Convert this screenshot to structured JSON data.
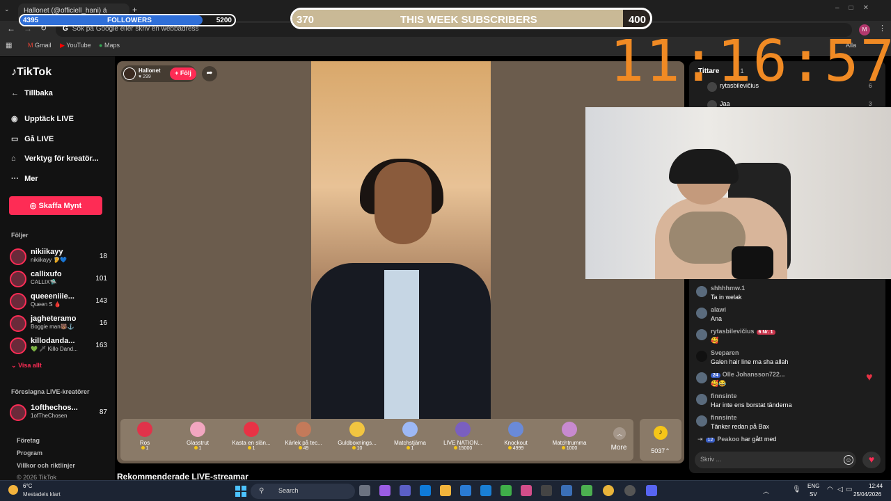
{
  "browser": {
    "tab_title": "Hallonet (@officiell_hani) ä",
    "omnibox_placeholder": "Sök på Google eller skriv en webbadress",
    "profile_initial": "M",
    "bookmarks": [
      "Gmail",
      "YouTube",
      "Maps"
    ],
    "all_bookmarks_label": "Alla"
  },
  "overlay": {
    "followers": {
      "label": "FOLLOWERS",
      "current": "4395",
      "goal": "5200",
      "progress": 0.85
    },
    "subscribers": {
      "label": "THIS WEEK SUBSCRIBERS",
      "current": "370",
      "goal": "400",
      "progress": 0.925
    },
    "clock": "11:16:57"
  },
  "sidebar": {
    "logo": "TikTok",
    "back_label": "Tillbaka",
    "nav": [
      {
        "label": "Upptäck LIVE",
        "icon": "live-avatar-icon"
      },
      {
        "label": "Gå LIVE",
        "icon": "video-camera-icon"
      },
      {
        "label": "Verktyg för kreatör...",
        "icon": "tools-icon"
      },
      {
        "label": "Mer",
        "icon": "more-dots-icon"
      }
    ],
    "coins_button": "Skaffa Mynt",
    "following_title": "Följer",
    "following": [
      {
        "name": "nikiikayy",
        "sub": "nikiikayy 🦻💙",
        "count": "18"
      },
      {
        "name": "callixufo",
        "sub": "CALLIX🛸",
        "count": "101"
      },
      {
        "name": "queeeniiie...",
        "sub": "Queen S 🩸",
        "count": "143"
      },
      {
        "name": "jagheteramo",
        "sub": "Boggie man🐻⚓",
        "count": "16"
      },
      {
        "name": "killodanda...",
        "sub": "💚 🗡 Killo Dand...",
        "count": "163"
      }
    ],
    "show_all": "Visa allt",
    "suggested_title": "Föreslagna LIVE-kreatörer",
    "suggested": [
      {
        "name": "1ofthechos...",
        "sub": "1ofTheChosen",
        "count": "87"
      }
    ],
    "footer": [
      "Företag",
      "Program",
      "Villkor och riktlinjer",
      "© 2026 TikTok"
    ]
  },
  "stage": {
    "host_name": "Hallonet",
    "host_likes": "♥ 299",
    "follow_label": "+ Följ",
    "gifts": [
      {
        "name": "Ros",
        "price": "1",
        "color": "#e0334a"
      },
      {
        "name": "Glasstrut",
        "price": "1",
        "color": "#f2a6c0"
      },
      {
        "name": "Kasta en slän...",
        "price": "1",
        "color": "#e83245"
      },
      {
        "name": "Kärlek på tec...",
        "price": "49",
        "color": "#c47a5a"
      },
      {
        "name": "Guldboxnings...",
        "price": "10",
        "color": "#f2c540"
      },
      {
        "name": "Matchstjärna",
        "price": "1",
        "color": "#9db8f5"
      },
      {
        "name": "LIVE NATION...",
        "price": "15000",
        "color": "#7a5fc0"
      },
      {
        "name": "Knockout",
        "price": "4999",
        "color": "#6a8ad8"
      },
      {
        "name": "Matchtrumma",
        "price": "1000",
        "color": "#c88ad0"
      }
    ],
    "more_label": "More",
    "coin_balance": "5037",
    "recommended_title": "Rekommenderade LIVE-streamar"
  },
  "chat": {
    "title": "Tittare",
    "info": "· 1",
    "viewers": [
      {
        "name": "rytasbilevičius",
        "rank": "6"
      },
      {
        "name": "Jaa",
        "rank": "3"
      }
    ],
    "messages": [
      {
        "user": "shhhhmw.1",
        "text": "Ta in welak"
      },
      {
        "user": "alawi",
        "text": "Ana"
      },
      {
        "user": "rytasbilevičius",
        "badge": "6 Nr. 1",
        "text": "🥰"
      },
      {
        "user": "Sveparen",
        "text": "Galen hair line ma sha allah"
      },
      {
        "user": "Olle Johansson722...",
        "level": "24",
        "text": "🥰😂"
      },
      {
        "user": "finnsinte",
        "text": "Har inte ens borstat tänderna"
      },
      {
        "user": "finnsinte",
        "text": "Tänker redan på Bax"
      }
    ],
    "join_event": {
      "level": "12",
      "user": "Peakoo",
      "text": "har gått med"
    },
    "input_placeholder": "Skriv ..."
  },
  "taskbar": {
    "weather_temp": "6°C",
    "weather_desc": "Mestadels klart",
    "search_label": "Search",
    "lang": "ENG",
    "region": "SV",
    "time": "12:44",
    "date": "25/04/2026"
  }
}
